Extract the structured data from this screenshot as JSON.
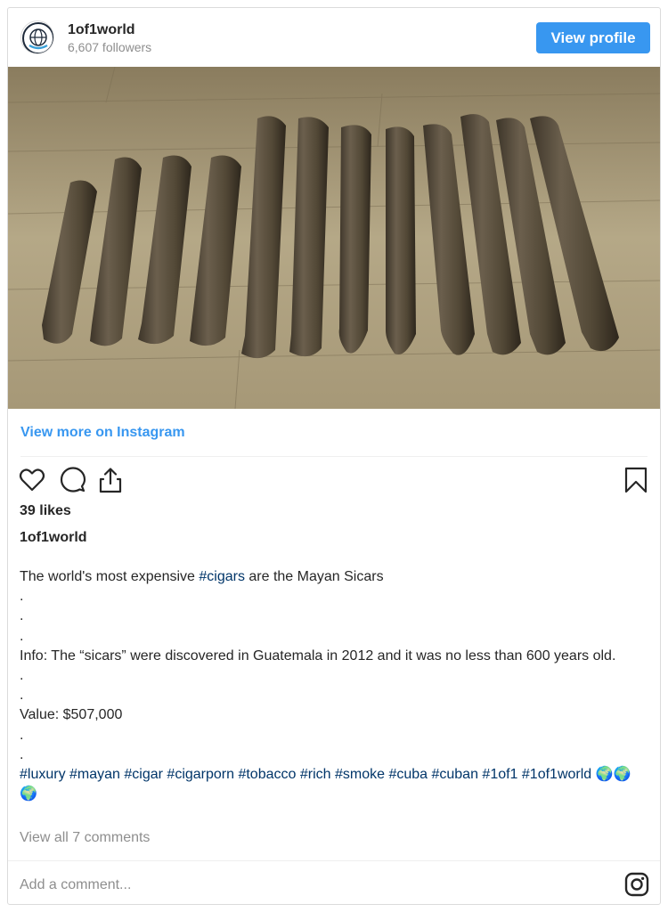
{
  "header": {
    "account_name": "1of1world",
    "followers": "6,607 followers",
    "view_profile_label": "View profile"
  },
  "post": {
    "image_alt": "Row of cigars on wooden table",
    "view_more_label": "View more on Instagram",
    "likes": "39 likes",
    "username": "1of1world",
    "caption_lines": [
      {
        "text": "The world's most expensive ",
        "tag": "#cigars",
        "after": " are the Mayan Sicars"
      },
      {
        "text": "."
      },
      {
        "text": "."
      },
      {
        "text": "."
      },
      {
        "text": "Info: The “sicars” were discovered in Guatemala in 2012 and it was no less than 600 years old."
      },
      {
        "text": "."
      },
      {
        "text": "."
      },
      {
        "text": "Value: $507,000"
      },
      {
        "text": "."
      },
      {
        "text": "."
      }
    ],
    "hashtags": "#luxury #mayan #cigar #cigarporn #tobacco #rich #smoke #cuba #cuban #1of1 #1of1world 🌍🌍🌍",
    "view_comments_label": "View all 7 comments",
    "add_comment_placeholder": "Add a comment..."
  },
  "icons": {
    "like": "heart-icon",
    "comment": "comment-icon",
    "share": "share-icon",
    "save": "bookmark-icon",
    "instagram": "instagram-icon"
  },
  "colors": {
    "accent": "#3897f0",
    "hashtag": "#003569",
    "muted": "#8e8e8e"
  }
}
